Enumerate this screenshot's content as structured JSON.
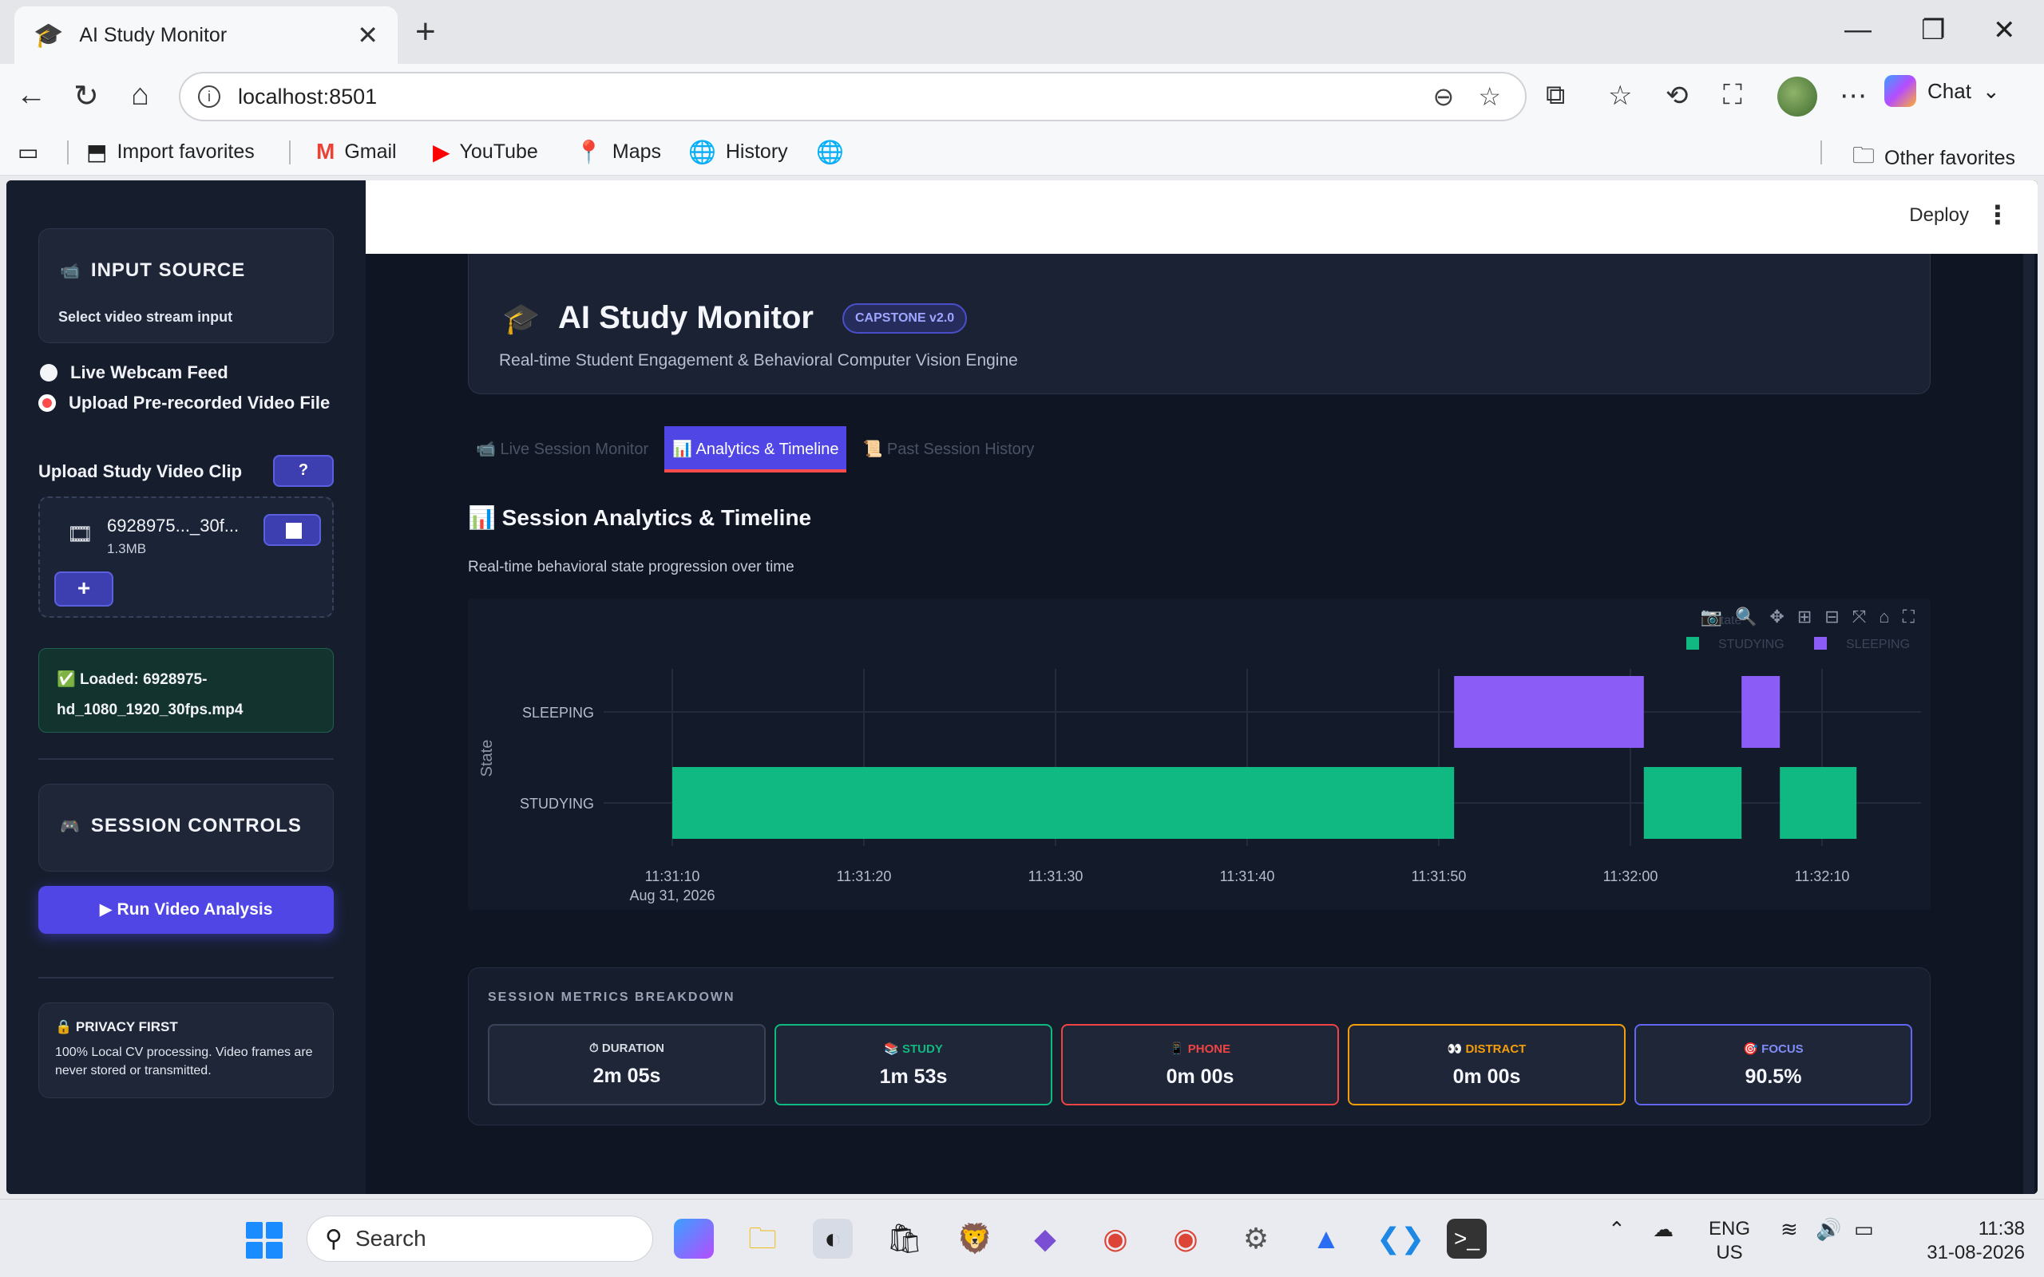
{
  "browser": {
    "tab_title": "AI Study Monitor",
    "url": "localhost:8501",
    "chat_label": "Chat",
    "favorites": [
      "Import favorites",
      "Gmail",
      "YouTube",
      "Maps",
      "History"
    ],
    "other_favorites": "Other favorites"
  },
  "topbar": {
    "deploy_label": "Deploy"
  },
  "sidebar": {
    "input_source": {
      "title": "INPUT SOURCE",
      "subtitle": "Select video stream input"
    },
    "radio_options": [
      {
        "label": "Live Webcam Feed",
        "selected": false
      },
      {
        "label": "Upload Pre-recorded Video File",
        "selected": true
      }
    ],
    "upload_label": "Upload Study Video Clip",
    "help_icon": "?",
    "file": {
      "name": "6928975..._30f...",
      "size": "1.3MB"
    },
    "add_label": "+",
    "loaded_text": "Loaded: 6928975-hd_1080_1920_30fps.mp4",
    "session_controls_title": "SESSION CONTROLS",
    "run_label": "▶ Run Video Analysis",
    "privacy": {
      "title": "PRIVACY FIRST",
      "body": "100% Local CV processing. Video frames are never stored or transmitted."
    }
  },
  "header": {
    "title": "AI Study Monitor",
    "badge": "CAPSTONE v2.0",
    "subtitle": "Real-time Student Engagement & Behavioral Computer Vision Engine"
  },
  "tabs": [
    {
      "label": "Live Session Monitor",
      "icon": "📹",
      "active": false
    },
    {
      "label": "Analytics & Timeline",
      "icon": "📊",
      "active": true
    },
    {
      "label": "Past Session History",
      "icon": "📜",
      "active": false
    }
  ],
  "section": {
    "title": "Session Analytics & Timeline",
    "subtitle": "Real-time behavioral state progression over time"
  },
  "chart_data": {
    "type": "timeline",
    "ylabel": "State",
    "categories": [
      "STUDYING",
      "SLEEPING"
    ],
    "x_ticks": [
      "11:31:10",
      "11:31:20",
      "11:31:30",
      "11:31:40",
      "11:31:50",
      "11:32:00",
      "11:32:10"
    ],
    "x_date_label": "Aug 31, 2026",
    "legend_title": "State",
    "legend": [
      {
        "name": "STUDYING",
        "color": "#10b981"
      },
      {
        "name": "SLEEPING",
        "color": "#8b5cf6"
      }
    ],
    "segments": [
      {
        "state": "STUDYING",
        "start": "11:31:10",
        "end": "11:31:50.8"
      },
      {
        "state": "SLEEPING",
        "start": "11:31:50.8",
        "end": "11:32:00.7"
      },
      {
        "state": "STUDYING",
        "start": "11:32:00.7",
        "end": "11:32:05.8"
      },
      {
        "state": "SLEEPING",
        "start": "11:32:05.8",
        "end": "11:32:07.8"
      },
      {
        "state": "STUDYING",
        "start": "11:32:07.8",
        "end": "11:32:11.8"
      }
    ]
  },
  "metrics": {
    "title": "SESSION METRICS BREAKDOWN",
    "cards": [
      {
        "label": "⏱ DURATION",
        "value": "2m 05s",
        "color": "#d7dbe4",
        "border": "#39435a"
      },
      {
        "label": "📚 STUDY",
        "value": "1m 53s",
        "color": "#10b981",
        "border": "#10b981"
      },
      {
        "label": "📱 PHONE",
        "value": "0m 00s",
        "color": "#ef4444",
        "border": "#ef4444"
      },
      {
        "label": "👀 DISTRACT",
        "value": "0m 00s",
        "color": "#f59e0b",
        "border": "#f59e0b"
      },
      {
        "label": "🎯 FOCUS",
        "value": "90.5%",
        "color": "#818cf8",
        "border": "#6366f1"
      }
    ]
  },
  "taskbar": {
    "search_placeholder": "Search",
    "lang": "ENG",
    "region": "US",
    "time": "11:38",
    "date": "31-08-2026"
  }
}
